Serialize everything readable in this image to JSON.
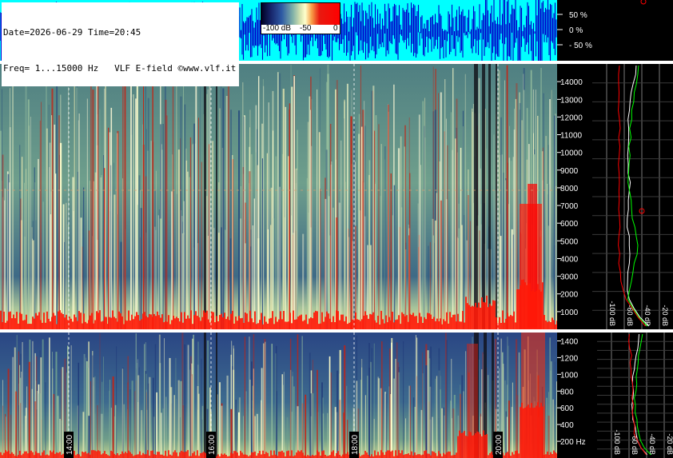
{
  "header": {
    "line1": "Date=2026-06-29 Time=20:45",
    "line2": "Freq= 1...15000 Hz   VLF E-field ©www.vlf.it"
  },
  "colorbar": {
    "labels": [
      "-100 dB",
      "-50",
      "0"
    ]
  },
  "chart_data": [
    {
      "type": "area",
      "panel": "waveform-amplitude",
      "y_ticks": [
        "50 %",
        "0 %",
        "- 50 %"
      ],
      "ylim": [
        -100,
        100
      ],
      "colors": {
        "background": "#00ffff",
        "trace": "#0000cc"
      }
    },
    {
      "type": "heatmap",
      "panel": "spectrogram-0-15000Hz",
      "y_ticks": [
        1000,
        2000,
        3000,
        4000,
        5000,
        6000,
        7000,
        8000,
        9000,
        10000,
        11000,
        12000,
        13000,
        14000
      ],
      "ylim": [
        0,
        15000
      ],
      "colors": {
        "low": "#16246a",
        "mid": "#7fb0a8",
        "high": "#ffffcc",
        "peak": "#ff0000"
      }
    },
    {
      "type": "heatmap",
      "panel": "spectrogram-0-1500Hz",
      "y_ticks": [
        "200 Hz",
        "400",
        "600",
        "800",
        "1000",
        "1200",
        "1400"
      ],
      "ylim": [
        0,
        1500
      ],
      "time_ticks": [
        "14:00",
        "16:00",
        "18:00",
        "20:00"
      ]
    },
    {
      "type": "line",
      "panel": "spectrum-profile-upper",
      "x_ticks": [
        "-100 dB",
        "-60 dB",
        "-40 dB",
        "-20 dB"
      ],
      "series": [
        {
          "color": "#ffffff",
          "values": [
            -46,
            -48,
            -50,
            -53,
            -54,
            -55,
            -55,
            -54,
            -55,
            -55,
            -56,
            -56,
            -55,
            -54,
            -55,
            -56,
            -56,
            -56,
            -56,
            -55,
            -55,
            -54,
            -54,
            -55,
            -56,
            -57,
            -55,
            -50,
            -42,
            -32
          ]
        },
        {
          "color": "#00ff00",
          "values": [
            -44,
            -45,
            -47,
            -49,
            -50,
            -52,
            -52,
            -53,
            -53,
            -54,
            -54,
            -55,
            -55,
            -55,
            -54,
            -53,
            -52,
            -50,
            -48,
            -46,
            -45,
            -46,
            -48,
            -50,
            -52,
            -54,
            -55,
            -51,
            -44,
            -34
          ]
        },
        {
          "color": "#ff0000",
          "values": [
            -66,
            -66,
            -66,
            -65,
            -66,
            -66,
            -66,
            -65,
            -66,
            -66,
            -66,
            -66,
            -65,
            -66,
            -66,
            -66,
            -66,
            -66,
            -65,
            -66,
            -66,
            -66,
            -66,
            -65,
            -64,
            -62,
            -58,
            -52,
            -45,
            -36
          ]
        }
      ]
    },
    {
      "type": "line",
      "panel": "spectrum-profile-lower",
      "x_ticks": [
        "-100 dB",
        "-60 dB",
        "-40 dB",
        "-20 dB"
      ],
      "series": [
        {
          "color": "#ffffff",
          "values": [
            -48,
            -49,
            -50,
            -52,
            -54,
            -54,
            -55,
            -56,
            -55,
            -55,
            -56,
            -57,
            -55,
            -54,
            -52,
            -50,
            -46,
            -40
          ]
        },
        {
          "color": "#00ff00",
          "values": [
            -44,
            -46,
            -48,
            -49,
            -50,
            -50,
            -51,
            -52,
            -52,
            -53,
            -53,
            -54,
            -52,
            -50,
            -49,
            -46,
            -42,
            -36
          ]
        },
        {
          "color": "#ff0000",
          "values": [
            -60,
            -60,
            -59,
            -58,
            -58,
            -57,
            -57,
            -56,
            -56,
            -56,
            -55,
            -56,
            -55,
            -54,
            -54,
            -51,
            -47,
            -40
          ]
        }
      ]
    }
  ]
}
